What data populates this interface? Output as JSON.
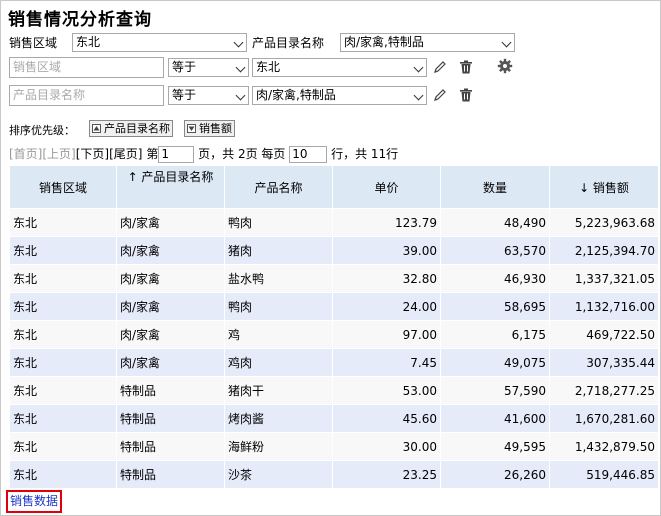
{
  "title": "销售情况分析查询",
  "filter_top": {
    "region_label": "销售区域",
    "region_value": "东北",
    "category_label": "产品目录名称",
    "category_value": "肉/家禽,特制品"
  },
  "condition_rows": [
    {
      "field_placeholder": "销售区域",
      "operator": "等于",
      "value": "东北"
    },
    {
      "field_placeholder": "产品目录名称",
      "operator": "等于",
      "value": "肉/家禽,特制品"
    }
  ],
  "sort": {
    "label": "排序优先级：",
    "items": [
      "产品目录名称",
      "销售额"
    ]
  },
  "pager": {
    "first": "[首页]",
    "prev": "[上页]",
    "next": "[下页]",
    "last": "[尾页]",
    "page_prefix": "第",
    "current_page": "1",
    "total_text": "页，共 2页 每页",
    "page_size": "10",
    "rows_text": "行，共 11行"
  },
  "table": {
    "headers": [
      "销售区域",
      "↑ 产品目录名称",
      "产品名称",
      "单价",
      "数量",
      "↓ 销售额"
    ],
    "rows": [
      [
        "东北",
        "肉/家禽",
        "鸭肉",
        "123.79",
        "48,490",
        "5,223,963.68"
      ],
      [
        "东北",
        "肉/家禽",
        "猪肉",
        "39.00",
        "63,570",
        "2,125,394.70"
      ],
      [
        "东北",
        "肉/家禽",
        "盐水鸭",
        "32.80",
        "46,930",
        "1,337,321.05"
      ],
      [
        "东北",
        "肉/家禽",
        "鸭肉",
        "24.00",
        "58,695",
        "1,132,716.00"
      ],
      [
        "东北",
        "肉/家禽",
        "鸡",
        "97.00",
        "6,175",
        "469,722.50"
      ],
      [
        "东北",
        "肉/家禽",
        "鸡肉",
        "7.45",
        "49,075",
        "307,335.44"
      ],
      [
        "东北",
        "特制品",
        "猪肉干",
        "53.00",
        "57,590",
        "2,718,277.25"
      ],
      [
        "东北",
        "特制品",
        "烤肉酱",
        "45.60",
        "41,600",
        "1,670,281.60"
      ],
      [
        "东北",
        "特制品",
        "海鲜粉",
        "30.00",
        "49,595",
        "1,432,879.50"
      ],
      [
        "东北",
        "特制品",
        "沙茶",
        "23.25",
        "26,260",
        "519,446.85"
      ]
    ]
  },
  "footer_link": "销售数据",
  "colors": {
    "header_bg": "#dde8f5",
    "alt_row": "#e6ebfa",
    "link": "#1a35c8",
    "highlight_border": "#e0000a"
  },
  "icons": [
    "chevron-down-icon",
    "pencil-icon",
    "trash-icon",
    "gear-icon",
    "sort-asc-icon",
    "sort-desc-icon"
  ]
}
